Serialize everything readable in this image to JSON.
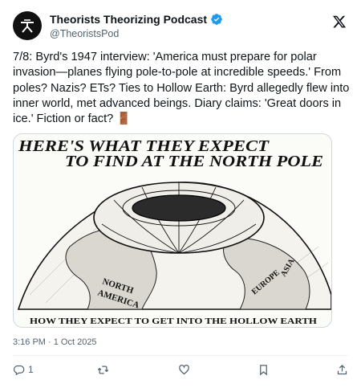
{
  "account": {
    "display_name": "Theorists Theorizing Podcast",
    "handle": "@TheoristsPod",
    "verified": true
  },
  "post": {
    "text": "7/8: Byrd's 1947 interview: 'America must prepare for polar invasion—planes flying pole-to-pole at incredible speeds.' From poles? Nazis? ETs? Ties to Hollow Earth: Byrd allegedly flew into inner world, met advanced beings. Diary claims: 'Great doors in ice.' Fiction or fact? 🚪",
    "timestamp": "3:16 PM · 1 Oct 2025"
  },
  "media": {
    "headline_line1": "HERE'S WHAT THEY EXPECT",
    "headline_line2": "TO FIND AT THE NORTH POLE",
    "label_north_america": "NORTH",
    "label_north_america_2": "AMERICA",
    "label_europe": "EUROPE",
    "label_asia": "ASIA",
    "caption": "HOW THEY EXPECT TO GET INTO THE HOLLOW EARTH"
  },
  "actions": {
    "reply_count": "1"
  },
  "icons": {
    "avatar": "theorists-logo-icon",
    "verified": "verified-badge-icon",
    "brand": "x-logo-icon",
    "reply": "reply-icon",
    "repost": "repost-icon",
    "like": "like-icon",
    "bookmark": "bookmark-icon",
    "share": "share-icon"
  },
  "colors": {
    "verified_blue": "#1d9bf0",
    "secondary_text": "#536471"
  }
}
